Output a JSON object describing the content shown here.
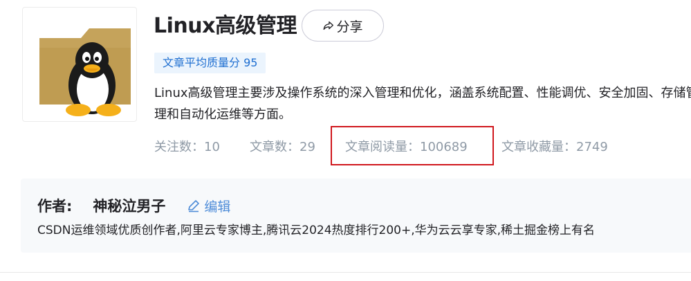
{
  "column": {
    "title": "Linux高级管理",
    "share_label": "分享",
    "quality_badge": "文章平均质量分 95",
    "description": "Linux高级管理主要涉及操作系统的深入管理和优化，涵盖系统配置、性能调优、安全加固、存储管理和自动化运维等方面。",
    "stats": {
      "follow": "关注数：10",
      "articles": "文章数：29",
      "reads": "文章阅读量：100689",
      "favorites": "文章收藏量：2749"
    }
  },
  "author": {
    "label": "作者:",
    "name": "神秘泣男子",
    "edit_label": "编辑",
    "bio": "CSDN运维领域优质创作者,阿里云专家博主,腾讯云2024热度排行200+,华为云云享专家,稀土掘金榜上有名"
  },
  "icons": {
    "share": "share-arrow-icon",
    "edit": "pencil-icon",
    "cover": "tux-folder-icon"
  },
  "colors": {
    "highlight": "#d0161c",
    "link": "#4e8cd8",
    "badge_bg": "#ebf4fd",
    "badge_text": "#1f6fd1"
  }
}
